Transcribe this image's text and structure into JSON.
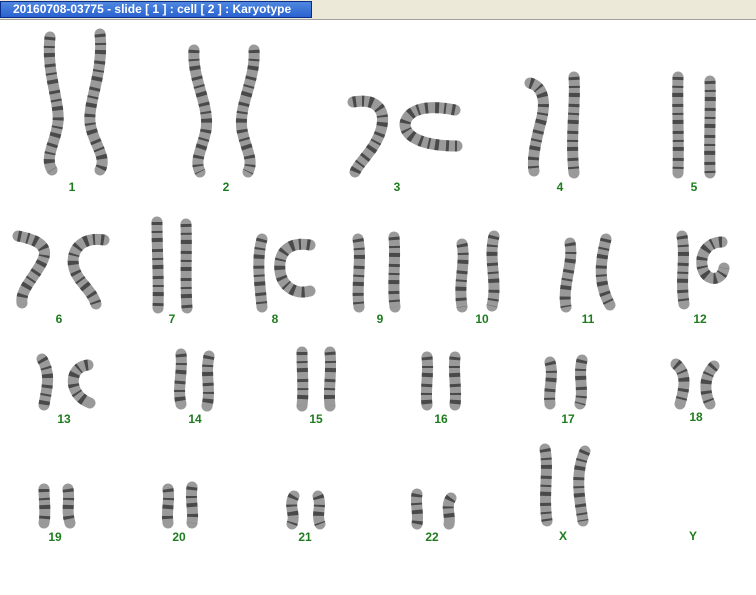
{
  "window": {
    "title": "20160708-03775 - slide [ 1 ] : cell [ 2 ] : Karyotype"
  },
  "colors": {
    "label": "#1e7c1e",
    "chromatid": "#9a9a9a",
    "band": "#2e2e2e",
    "tab": "#3a73d8"
  },
  "karyotype": [
    {
      "label": "1",
      "shape": "curved-out"
    },
    {
      "label": "2",
      "shape": "curved-out"
    },
    {
      "label": "3",
      "shape": "bent-horizontal"
    },
    {
      "label": "4",
      "shape": "straight"
    },
    {
      "label": "5",
      "shape": "straight"
    },
    {
      "label": "6",
      "shape": "bent"
    },
    {
      "label": "7",
      "shape": "straight"
    },
    {
      "label": "8",
      "shape": "bent"
    },
    {
      "label": "9",
      "shape": "straight"
    },
    {
      "label": "10",
      "shape": "straight"
    },
    {
      "label": "11",
      "shape": "straight"
    },
    {
      "label": "12",
      "shape": "straight"
    },
    {
      "label": "13",
      "shape": "curved-in"
    },
    {
      "label": "14",
      "shape": "straight"
    },
    {
      "label": "15",
      "shape": "straight"
    },
    {
      "label": "16",
      "shape": "straight"
    },
    {
      "label": "17",
      "shape": "straight"
    },
    {
      "label": "18",
      "shape": "straight"
    },
    {
      "label": "19",
      "shape": "small"
    },
    {
      "label": "20",
      "shape": "small"
    },
    {
      "label": "21",
      "shape": "small"
    },
    {
      "label": "22",
      "shape": "small"
    },
    {
      "label": "X",
      "shape": "straight"
    },
    {
      "label": "Y",
      "shape": "absent"
    }
  ]
}
